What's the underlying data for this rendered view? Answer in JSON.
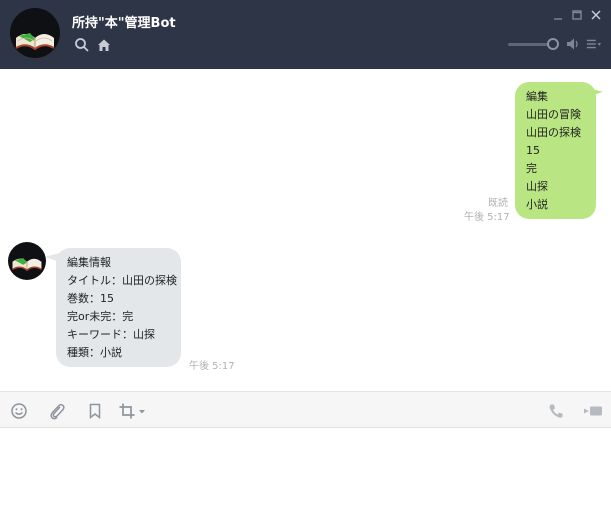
{
  "header": {
    "title": "所持\"本\"管理Bot",
    "icons": [
      "search-icon",
      "home-icon",
      "minimize-icon",
      "maximize-icon",
      "close-icon",
      "volume-icon",
      "menu-icon"
    ],
    "volume_level": 0.9,
    "bg_color": "#2d3547"
  },
  "messages": {
    "outgoing": {
      "lines": [
        "編集",
        "山田の冒険",
        "山田の探検",
        "15",
        "完",
        "山探",
        "小説"
      ],
      "read_label": "既読",
      "time": "午後 5:17",
      "color": "#b9e682"
    },
    "incoming": {
      "lines": [
        "編集情報",
        "タイトル：山田の探検",
        "巻数：15",
        "完or未完：完",
        "キーワード：山探",
        "種類：小説"
      ],
      "time": "午後 5:17",
      "color": "#e4e7ea"
    }
  },
  "toolbar": {
    "icons": [
      "emoji-icon",
      "attach-icon",
      "bookmark-icon",
      "screenshot-crop-icon",
      "call-icon",
      "video-call-icon"
    ]
  }
}
